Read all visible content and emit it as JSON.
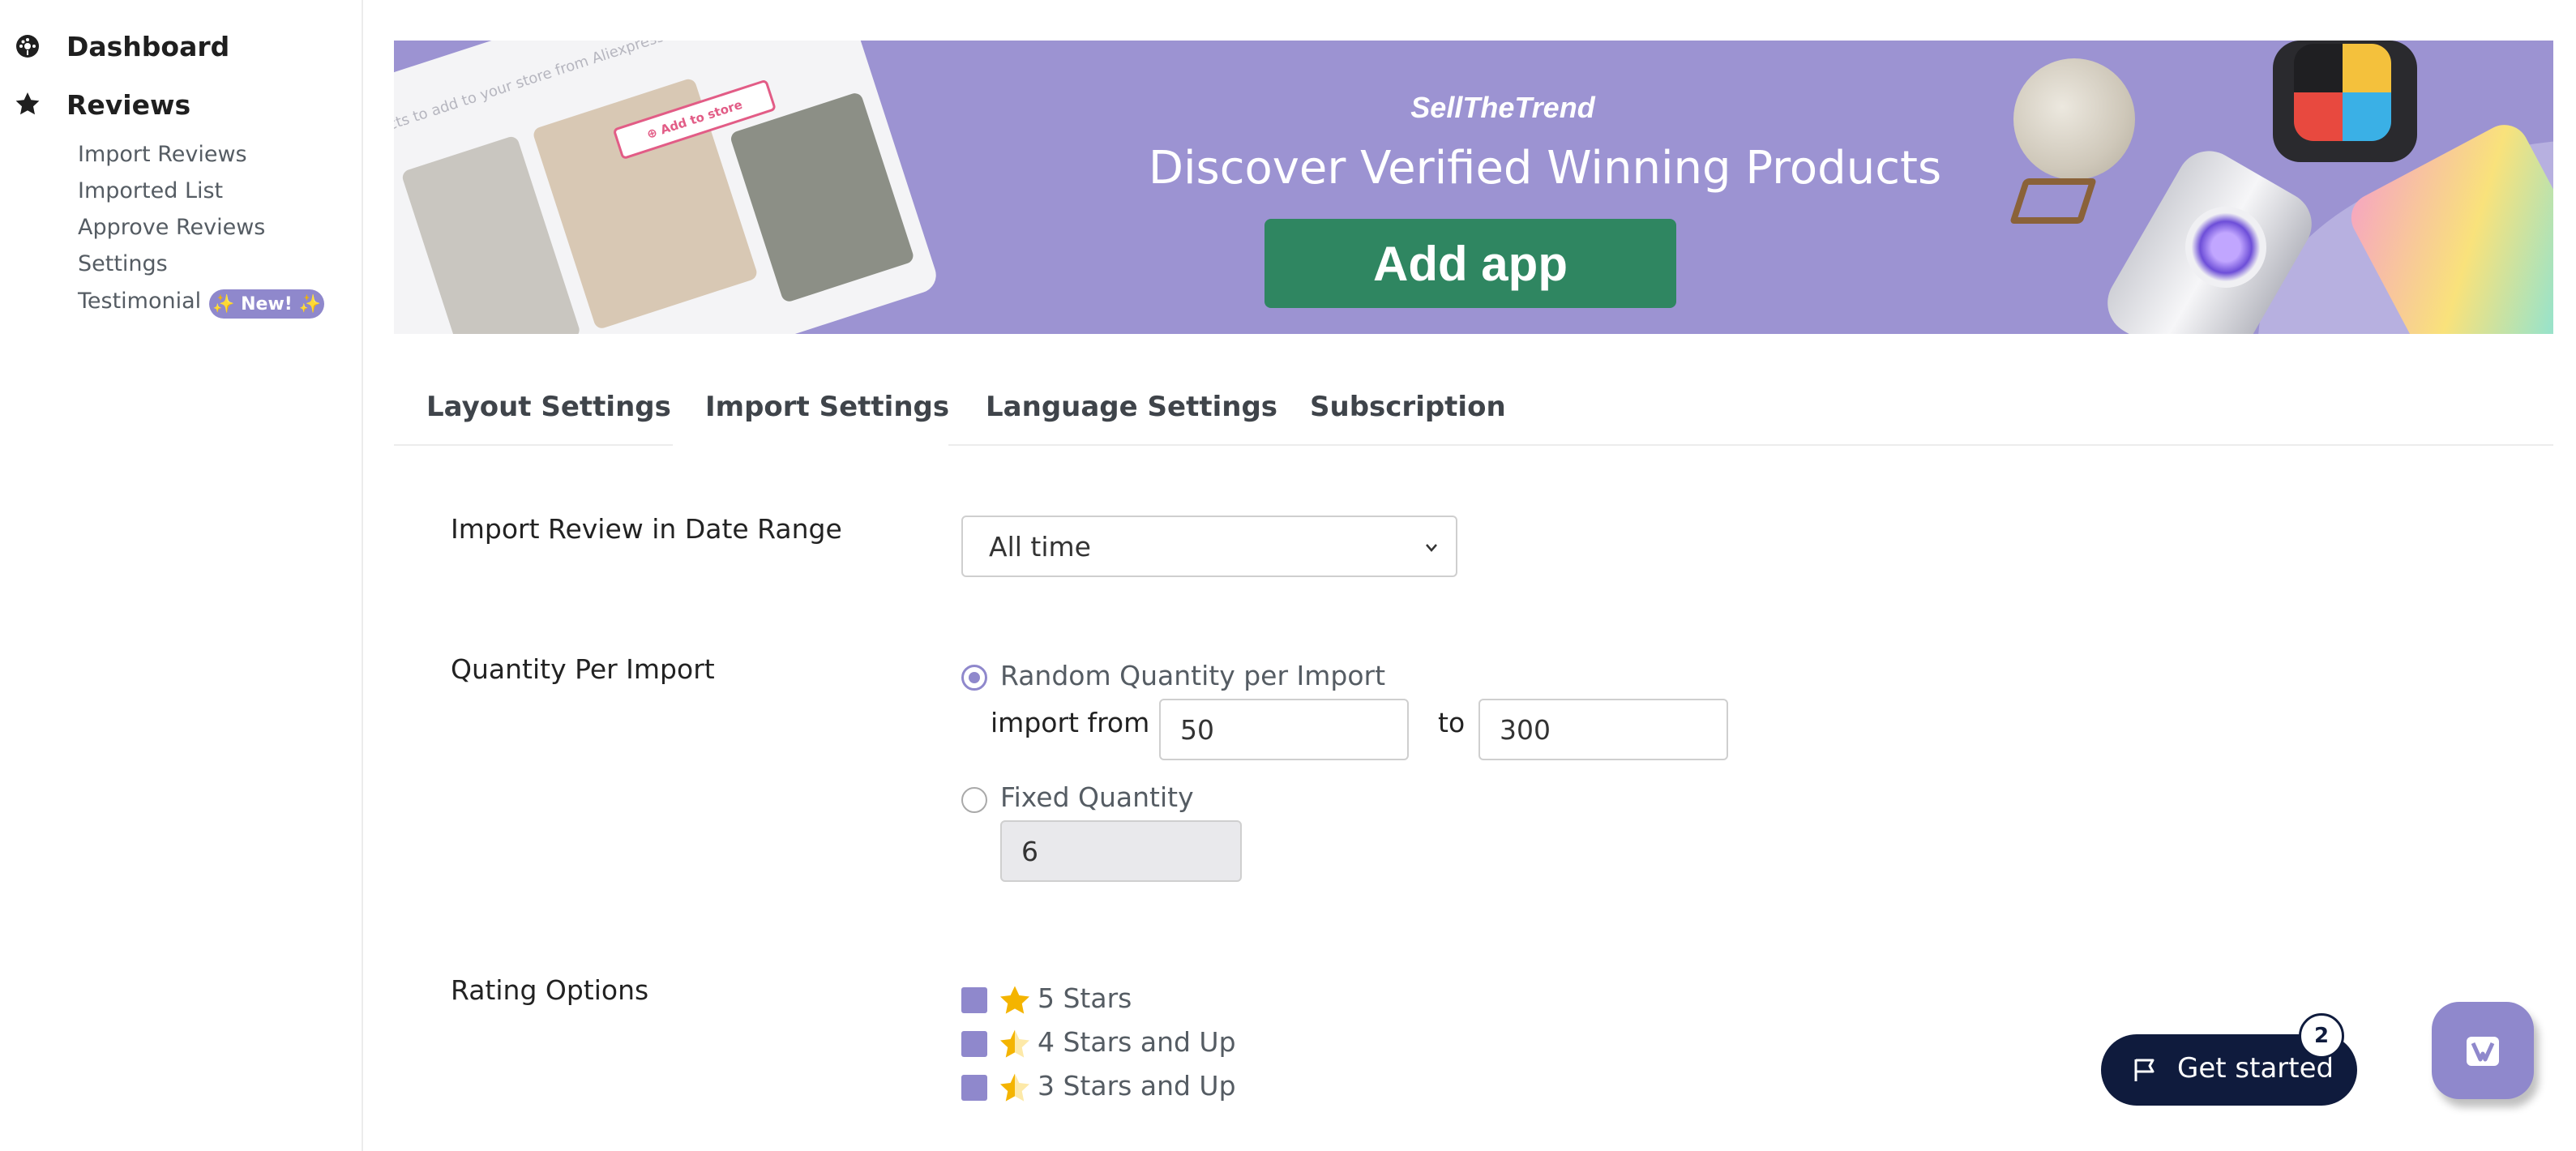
{
  "sidebar": {
    "dashboard": "Dashboard",
    "reviews": "Reviews",
    "items": [
      "Import Reviews",
      "Imported List",
      "Approve Reviews",
      "Settings",
      "Testimonial"
    ],
    "new_badge": "✨ New! ✨"
  },
  "banner": {
    "store_text": "oducts to add to your store from Aliexpress",
    "add_to_store": "⊕ Add to store",
    "brand": "SellTheTrend",
    "headline": "Discover Verified Winning Products",
    "button": "Add app"
  },
  "tabs": [
    "Layout Settings",
    "Import Settings",
    "Language Settings",
    "Subscription"
  ],
  "form": {
    "date_range": {
      "label": "Import Review in Date Range",
      "selected": "All time"
    },
    "quantity": {
      "label": "Quantity Per Import",
      "random_option": "Random Quantity per Import",
      "import_from": "import from",
      "from_value": "50",
      "to": "to",
      "to_value": "300",
      "fixed_option": "Fixed Quantity",
      "fixed_value": "6"
    },
    "rating": {
      "label": "Rating Options",
      "options": [
        "5 Stars",
        "4 Stars and Up",
        "3 Stars and Up"
      ]
    }
  },
  "floating": {
    "get_started": "Get started",
    "count": "2"
  },
  "colors": {
    "accent": "#8f88cc",
    "banner": "#9c93d2",
    "cta": "#2f8661",
    "get_started": "#0f1b3d",
    "star": "#f4b400"
  }
}
